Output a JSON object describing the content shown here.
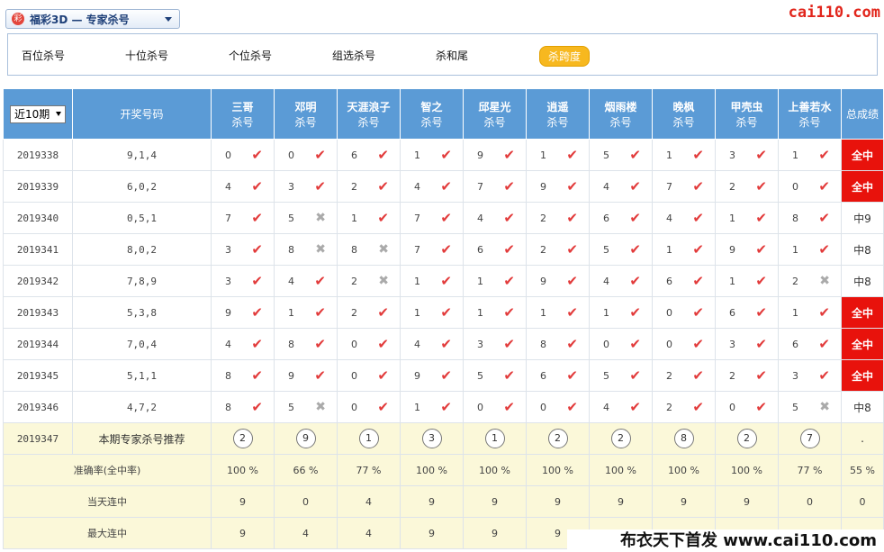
{
  "header": {
    "lottery_label": "福彩3D — 专家杀号",
    "lottery_icon_text": "彩",
    "site_logo": "cai110.com"
  },
  "tabs": [
    {
      "label": "百位杀号"
    },
    {
      "label": "十位杀号"
    },
    {
      "label": "个位杀号"
    },
    {
      "label": "组选杀号"
    },
    {
      "label": "杀和尾"
    },
    {
      "label": "杀跨度",
      "active": true
    }
  ],
  "table": {
    "period_select": "近10期",
    "draw_header": "开奖号码",
    "total_header": "总成绩",
    "experts": [
      {
        "name": "三哥",
        "sub": "杀号"
      },
      {
        "name": "邓明",
        "sub": "杀号"
      },
      {
        "name": "天涯浪子",
        "sub": "杀号"
      },
      {
        "name": "智之",
        "sub": "杀号"
      },
      {
        "name": "邱星光",
        "sub": "杀号"
      },
      {
        "name": "逍遥",
        "sub": "杀号"
      },
      {
        "name": "烟雨楼",
        "sub": "杀号"
      },
      {
        "name": "晚枫",
        "sub": "杀号"
      },
      {
        "name": "甲壳虫",
        "sub": "杀号"
      },
      {
        "name": "上善若水",
        "sub": "杀号"
      }
    ],
    "rows": [
      {
        "issue": "2019338",
        "draw": "9,1,4",
        "kills": [
          "0",
          "0",
          "6",
          "1",
          "9",
          "1",
          "5",
          "1",
          "3",
          "1"
        ],
        "hits": [
          1,
          1,
          1,
          1,
          1,
          1,
          1,
          1,
          1,
          1
        ],
        "total": "全中",
        "full": true
      },
      {
        "issue": "2019339",
        "draw": "6,0,2",
        "kills": [
          "4",
          "3",
          "2",
          "4",
          "7",
          "9",
          "4",
          "7",
          "2",
          "0"
        ],
        "hits": [
          1,
          1,
          1,
          1,
          1,
          1,
          1,
          1,
          1,
          1
        ],
        "total": "全中",
        "full": true
      },
      {
        "issue": "2019340",
        "draw": "0,5,1",
        "kills": [
          "7",
          "5",
          "1",
          "7",
          "4",
          "2",
          "6",
          "4",
          "1",
          "8"
        ],
        "hits": [
          1,
          0,
          1,
          1,
          1,
          1,
          1,
          1,
          1,
          1
        ],
        "total": "中9",
        "full": false
      },
      {
        "issue": "2019341",
        "draw": "8,0,2",
        "kills": [
          "3",
          "8",
          "8",
          "7",
          "6",
          "2",
          "5",
          "1",
          "9",
          "1"
        ],
        "hits": [
          1,
          0,
          0,
          1,
          1,
          1,
          1,
          1,
          1,
          1
        ],
        "total": "中8",
        "full": false
      },
      {
        "issue": "2019342",
        "draw": "7,8,9",
        "kills": [
          "3",
          "4",
          "2",
          "1",
          "1",
          "9",
          "4",
          "6",
          "1",
          "2"
        ],
        "hits": [
          1,
          1,
          0,
          1,
          1,
          1,
          1,
          1,
          1,
          0
        ],
        "total": "中8",
        "full": false
      },
      {
        "issue": "2019343",
        "draw": "5,3,8",
        "kills": [
          "9",
          "1",
          "2",
          "1",
          "1",
          "1",
          "1",
          "0",
          "6",
          "1"
        ],
        "hits": [
          1,
          1,
          1,
          1,
          1,
          1,
          1,
          1,
          1,
          1
        ],
        "total": "全中",
        "full": true
      },
      {
        "issue": "2019344",
        "draw": "7,0,4",
        "kills": [
          "4",
          "8",
          "0",
          "4",
          "3",
          "8",
          "0",
          "0",
          "3",
          "6"
        ],
        "hits": [
          1,
          1,
          1,
          1,
          1,
          1,
          1,
          1,
          1,
          1
        ],
        "total": "全中",
        "full": true
      },
      {
        "issue": "2019345",
        "draw": "5,1,1",
        "kills": [
          "8",
          "9",
          "0",
          "9",
          "5",
          "6",
          "5",
          "2",
          "2",
          "3"
        ],
        "hits": [
          1,
          1,
          1,
          1,
          1,
          1,
          1,
          1,
          1,
          1
        ],
        "total": "全中",
        "full": true
      },
      {
        "issue": "2019346",
        "draw": "4,7,2",
        "kills": [
          "8",
          "5",
          "0",
          "1",
          "0",
          "0",
          "4",
          "2",
          "0",
          "5"
        ],
        "hits": [
          1,
          0,
          1,
          1,
          1,
          1,
          1,
          1,
          1,
          0
        ],
        "total": "中8",
        "full": false
      }
    ],
    "recommend": {
      "issue": "2019347",
      "label": "本期专家杀号推荐",
      "numbers": [
        "2",
        "9",
        "1",
        "3",
        "1",
        "2",
        "2",
        "8",
        "2",
        "7"
      ],
      "total": "."
    },
    "stats": [
      {
        "label": "准确率(全中率)",
        "values": [
          "100 %",
          "66 %",
          "77 %",
          "100 %",
          "100 %",
          "100 %",
          "100 %",
          "100 %",
          "100 %",
          "77 %"
        ],
        "total": "55 %"
      },
      {
        "label": "当天连中",
        "values": [
          "9",
          "0",
          "4",
          "9",
          "9",
          "9",
          "9",
          "9",
          "9",
          "0"
        ],
        "total": "0"
      },
      {
        "label": "最大连中",
        "values": [
          "9",
          "4",
          "4",
          "9",
          "9",
          "9",
          "9",
          "9",
          "9",
          "9"
        ],
        "total": ""
      }
    ]
  },
  "watermark": "布衣天下首发 www.cai110.com"
}
